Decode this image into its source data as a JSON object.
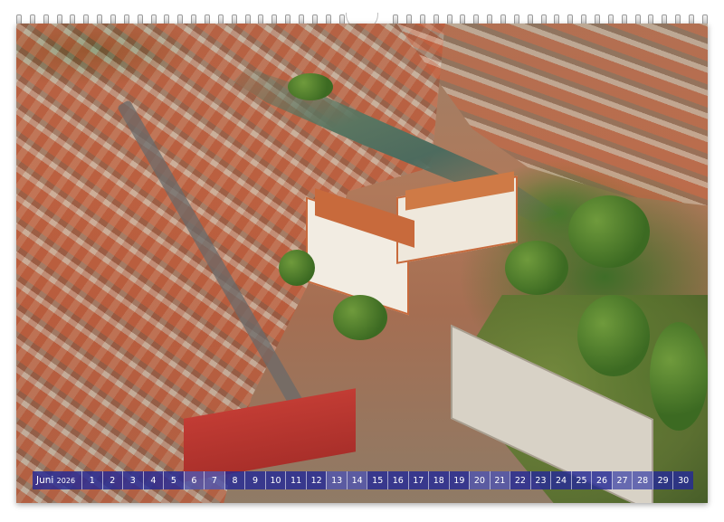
{
  "calendar": {
    "month": "Juni",
    "year": "2026",
    "days": [
      "1",
      "2",
      "3",
      "4",
      "5",
      "6",
      "7",
      "8",
      "9",
      "10",
      "11",
      "12",
      "13",
      "14",
      "15",
      "16",
      "17",
      "18",
      "19",
      "20",
      "21",
      "22",
      "23",
      "24",
      "25",
      "26",
      "27",
      "28",
      "29",
      "30"
    ],
    "weekend_days": [
      "6",
      "7",
      "13",
      "14",
      "20",
      "21",
      "27",
      "28"
    ]
  },
  "photo": {
    "subject": "aerial view of old town with river and manor"
  },
  "colors": {
    "strip": "#242a96",
    "roof": "#c86a3c",
    "park": "#556f2c"
  }
}
